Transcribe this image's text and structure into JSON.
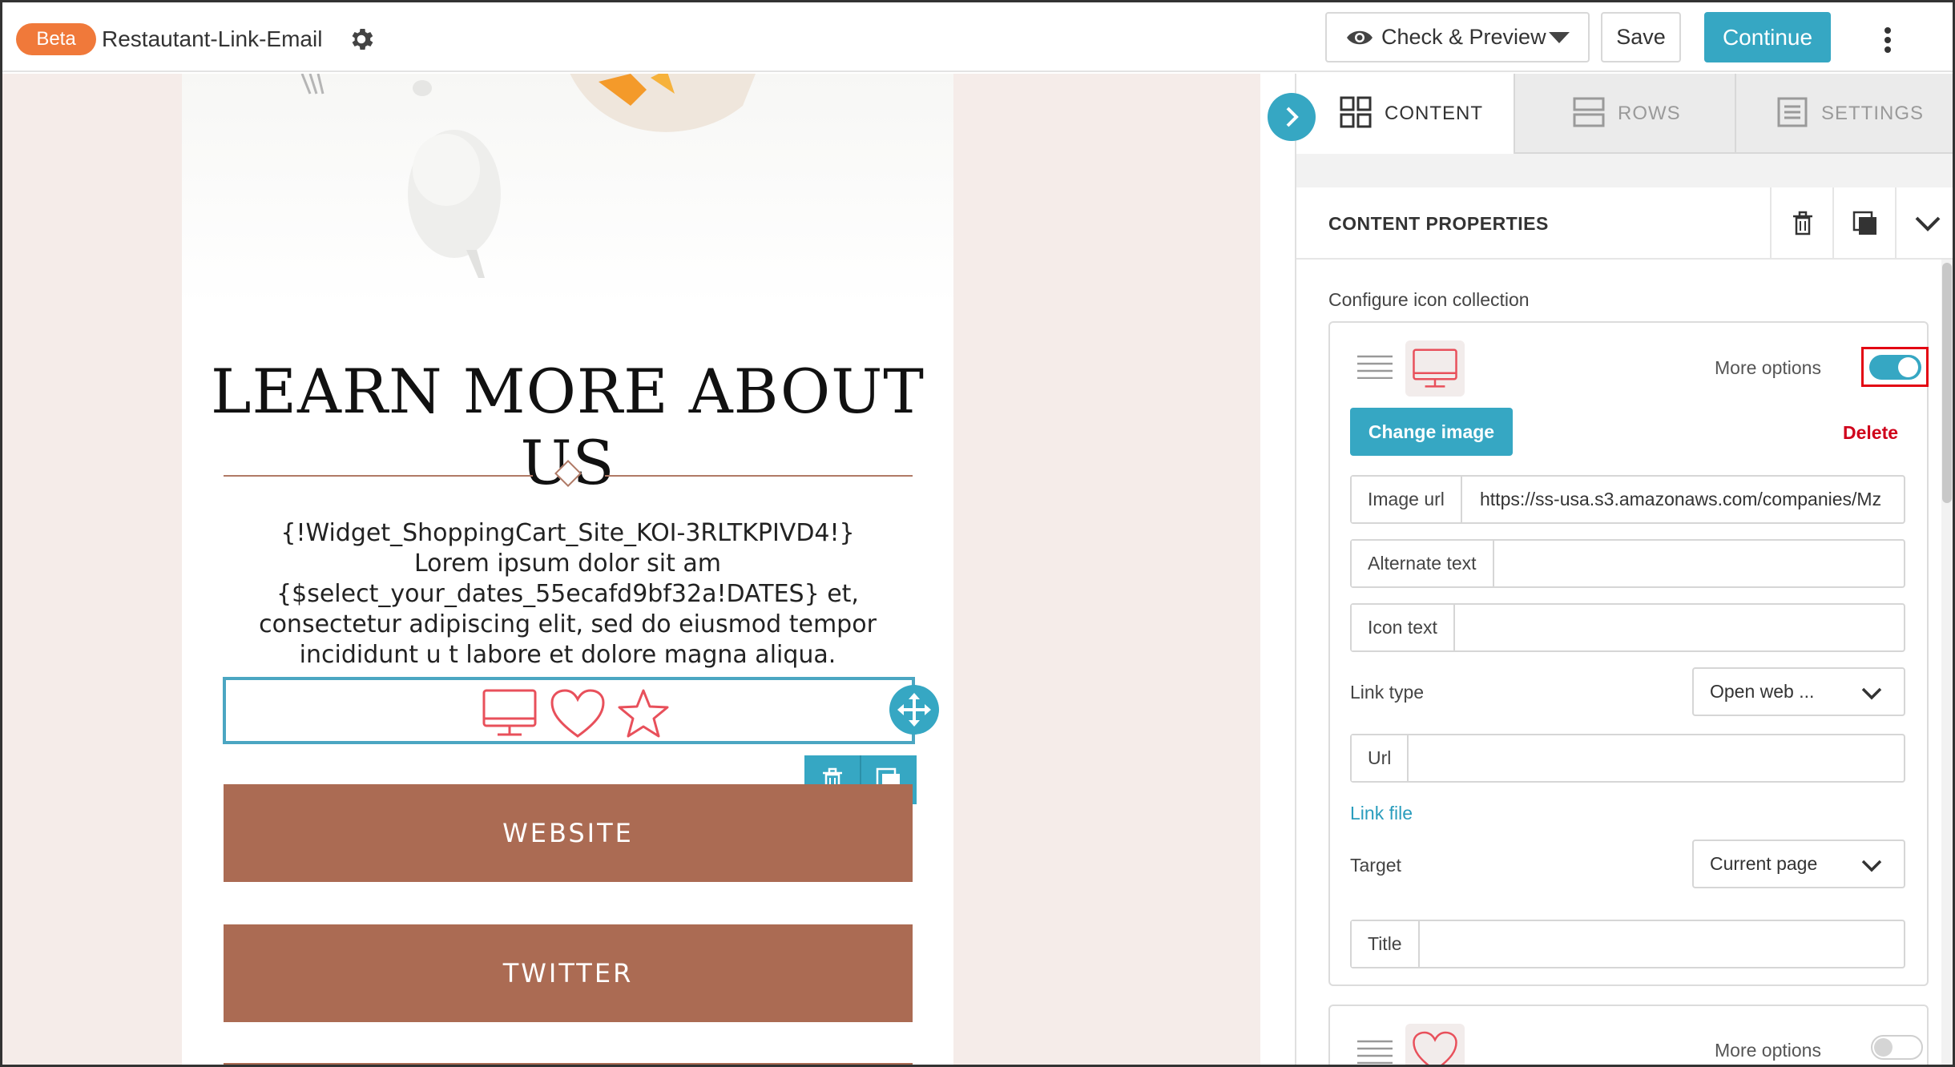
{
  "header": {
    "badge": "Beta",
    "doc_title": "Restautant-Link-Email",
    "preview_label": "Check & Preview",
    "save_label": "Save",
    "continue_label": "Continue"
  },
  "email": {
    "heading": "LEARN MORE ABOUT US",
    "body_lines": [
      "{!Widget_ShoppingCart_Site_KOI-3RLTKPIVD4!}",
      "Lorem ipsum dolor sit am",
      "{$select_your_dates_55ecafd9bf32a!DATES} et,",
      "consectetur adipiscing elit, sed do eiusmod tempor",
      "incididunt u t labore et dolore magna aliqua."
    ],
    "icons": [
      "monitor-icon",
      "heart-icon",
      "star-icon"
    ],
    "buttons": [
      "WEBSITE",
      "TWITTER"
    ]
  },
  "panel": {
    "tabs": [
      {
        "label": "CONTENT",
        "active": true
      },
      {
        "label": "ROWS",
        "active": false
      },
      {
        "label": "SETTINGS",
        "active": false
      }
    ],
    "props_title": "CONTENT PROPERTIES",
    "config_label": "Configure icon collection",
    "item1": {
      "more_options": "More options",
      "more_options_on": true,
      "change_image": "Change image",
      "delete": "Delete",
      "image_url_label": "Image url",
      "image_url_value": "https://ss-usa.s3.amazonaws.com/companies/Mz",
      "alt_text_label": "Alternate text",
      "alt_text_value": "",
      "icon_text_label": "Icon text",
      "icon_text_value": "",
      "link_type_label": "Link type",
      "link_type_value": "Open web ...",
      "url_label": "Url",
      "url_value": "",
      "link_file": "Link file",
      "target_label": "Target",
      "target_value": "Current page",
      "title_label": "Title",
      "title_value": ""
    },
    "item2": {
      "more_options": "More options",
      "more_options_on": false
    }
  },
  "colors": {
    "accent": "#36a7c3",
    "badge": "#f0793a",
    "cta": "#ab6b53",
    "icon_red": "#e8505b",
    "delete": "#d0021b",
    "highlight": "#e30613"
  }
}
